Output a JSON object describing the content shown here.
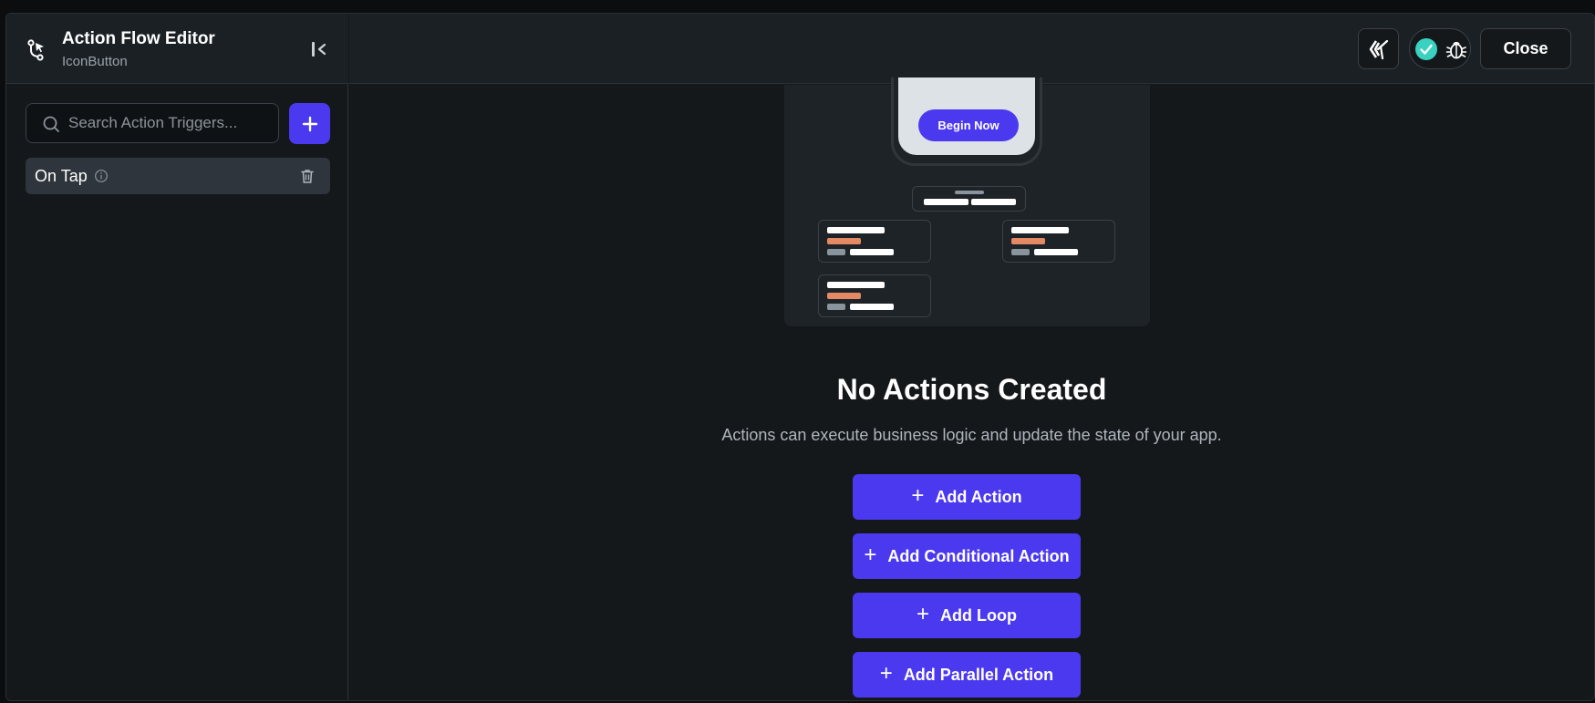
{
  "sidebar": {
    "title": "Action Flow Editor",
    "subtitle": "IconButton",
    "search": {
      "placeholder": "Search Action Triggers...",
      "value": ""
    },
    "add_button_icon": "plus-icon",
    "triggers": [
      {
        "label": "On Tap"
      }
    ]
  },
  "header": {
    "close_label": "Close",
    "status_color": "#39d2c0"
  },
  "illustration": {
    "button_label": "Begin Now"
  },
  "empty_state": {
    "title": "No Actions Created",
    "description": "Actions can execute business logic and update the state of your app."
  },
  "actions": [
    {
      "label": "Add Action"
    },
    {
      "label": "Add Conditional Action"
    },
    {
      "label": "Add Loop"
    },
    {
      "label": "Add Parallel Action"
    }
  ],
  "colors": {
    "accent": "#4b39ef",
    "background": "#14181b",
    "panel": "#1b2024",
    "success": "#39d2c0",
    "highlight_bar": "#e38a64"
  }
}
